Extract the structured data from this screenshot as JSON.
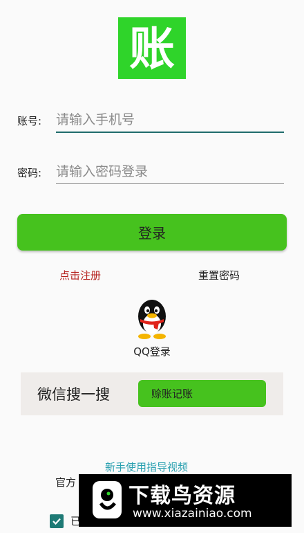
{
  "logo": {
    "char": "账",
    "bg_color": "#2fd42a"
  },
  "form": {
    "account_label": "账号:",
    "account_placeholder": "请输入手机号",
    "password_label": "密码:",
    "password_placeholder": "请输入密码登录"
  },
  "login_button": "登录",
  "links": {
    "register": "点击注册",
    "reset": "重置密码"
  },
  "qq": {
    "icon": "qq-penguin-icon",
    "label": "QQ登录"
  },
  "wechat": {
    "text": "微信搜一搜",
    "search_value": "赊账记账"
  },
  "guide_link": "新手使用指导视频",
  "official_prefix": "官方",
  "agreement": {
    "checked": true,
    "text": "已"
  },
  "watermark": {
    "title": "下载鸟资源",
    "url": "www.xiazainiao.com"
  },
  "colors": {
    "accent_green": "#46c21e",
    "register_red": "#b5201d",
    "link_teal": "#2aa0b0",
    "checkbox_teal": "#1e7a75"
  }
}
